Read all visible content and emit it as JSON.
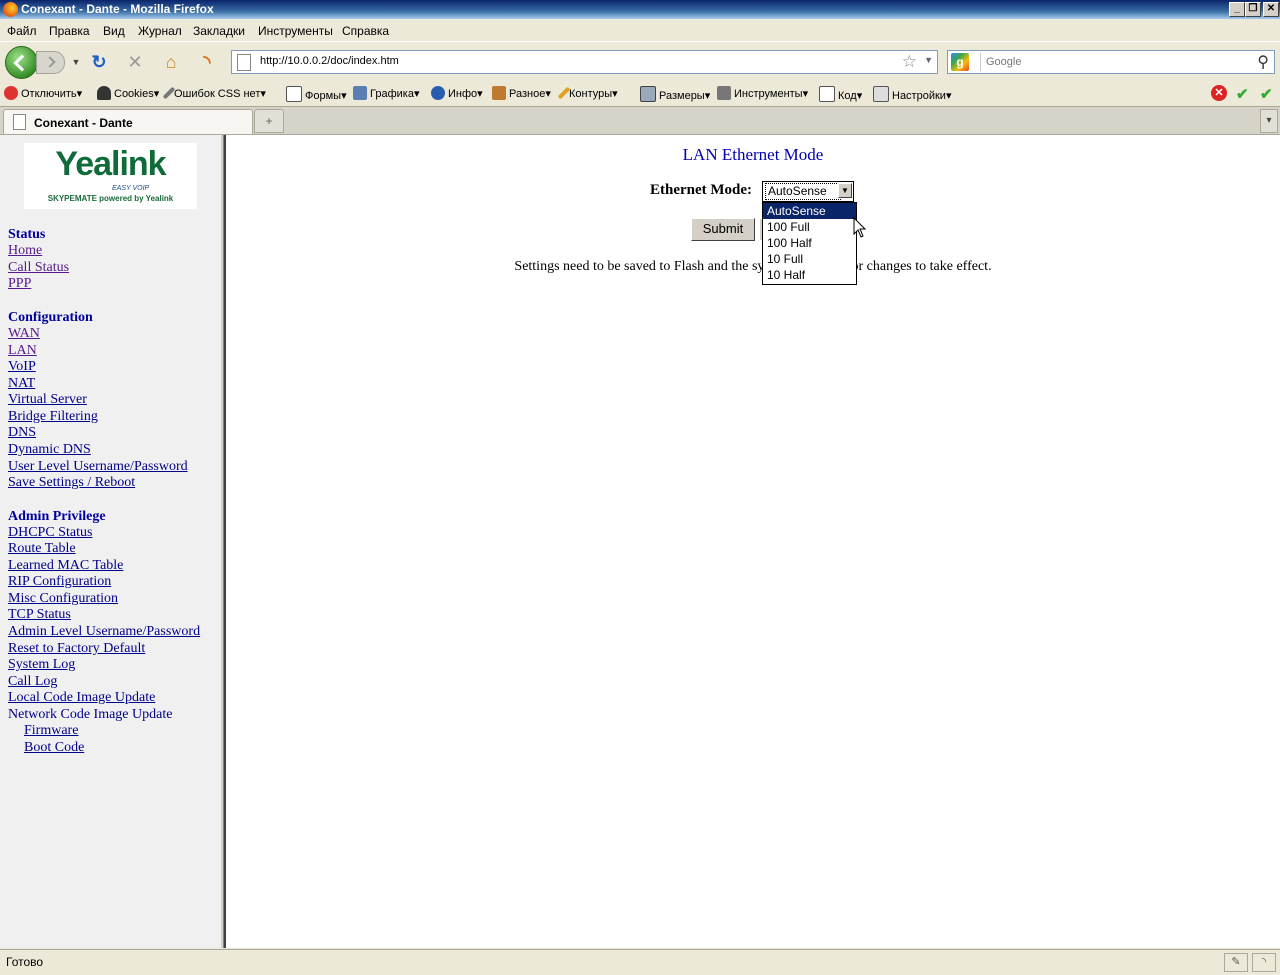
{
  "window": {
    "title": "Conexant - Dante - Mozilla Firefox",
    "minimize": "_",
    "restore": "❐",
    "close": "✕"
  },
  "menu": [
    "Файл",
    "Правка",
    "Вид",
    "Журнал",
    "Закладки",
    "Инструменты",
    "Справка"
  ],
  "nav": {
    "url": "http://10.0.0.2/doc/index.htm",
    "search_placeholder": "Google",
    "search_engine_glyph": "g"
  },
  "devtoolbar": {
    "items": [
      "Отключить",
      "Cookies",
      "Ошибок CSS нет",
      "Формы",
      "Графика",
      "Инфо",
      "Разное",
      "Контуры",
      "Размеры",
      "Инструменты",
      "Код",
      "Настройки"
    ]
  },
  "tabs": {
    "active_label": "Conexant - Dante"
  },
  "logo": {
    "brand": "Yealink",
    "tagline": "EASY VOIP",
    "subline": "SKYPEMATE powered by Yealink"
  },
  "sidebar": {
    "status_heading": "Status",
    "status_links": [
      "Home",
      "Call Status",
      "PPP"
    ],
    "config_heading": "Configuration",
    "config_links": [
      "WAN",
      "LAN",
      "VoIP",
      "NAT",
      "Virtual Server",
      "Bridge Filtering",
      "DNS",
      "Dynamic DNS",
      "User Level Username/Password",
      "Save Settings / Reboot"
    ],
    "admin_heading": "Admin Privilege",
    "admin_links": [
      "DHCPC Status",
      "Route Table",
      "Learned MAC Table",
      "RIP Configuration",
      "Misc Configuration",
      "TCP Status",
      "Admin Level Username/Password",
      "Reset to Factory Default",
      "System Log",
      "Call Log",
      "Local Code Image Update"
    ],
    "network_update_label": "Network Code Image Update",
    "network_update_links": [
      "Firmware",
      "Boot Code"
    ]
  },
  "main": {
    "heading": "LAN Ethernet Mode",
    "ethernet_mode_label": "Ethernet Mode:",
    "ethernet_mode_value": "AutoSense",
    "ethernet_mode_options": [
      "AutoSense",
      "100 Full",
      "100 Half",
      "10 Full",
      "10 Half"
    ],
    "submit_label": "Submit",
    "notice": "Settings need to be saved to Flash and the system rebooted for changes to take effect."
  },
  "statusbar": {
    "text": "Готово"
  },
  "colors": {
    "link": "#00008b",
    "visited": "#551a8b",
    "heading": "#0000b0",
    "selection": "#0a246a"
  }
}
